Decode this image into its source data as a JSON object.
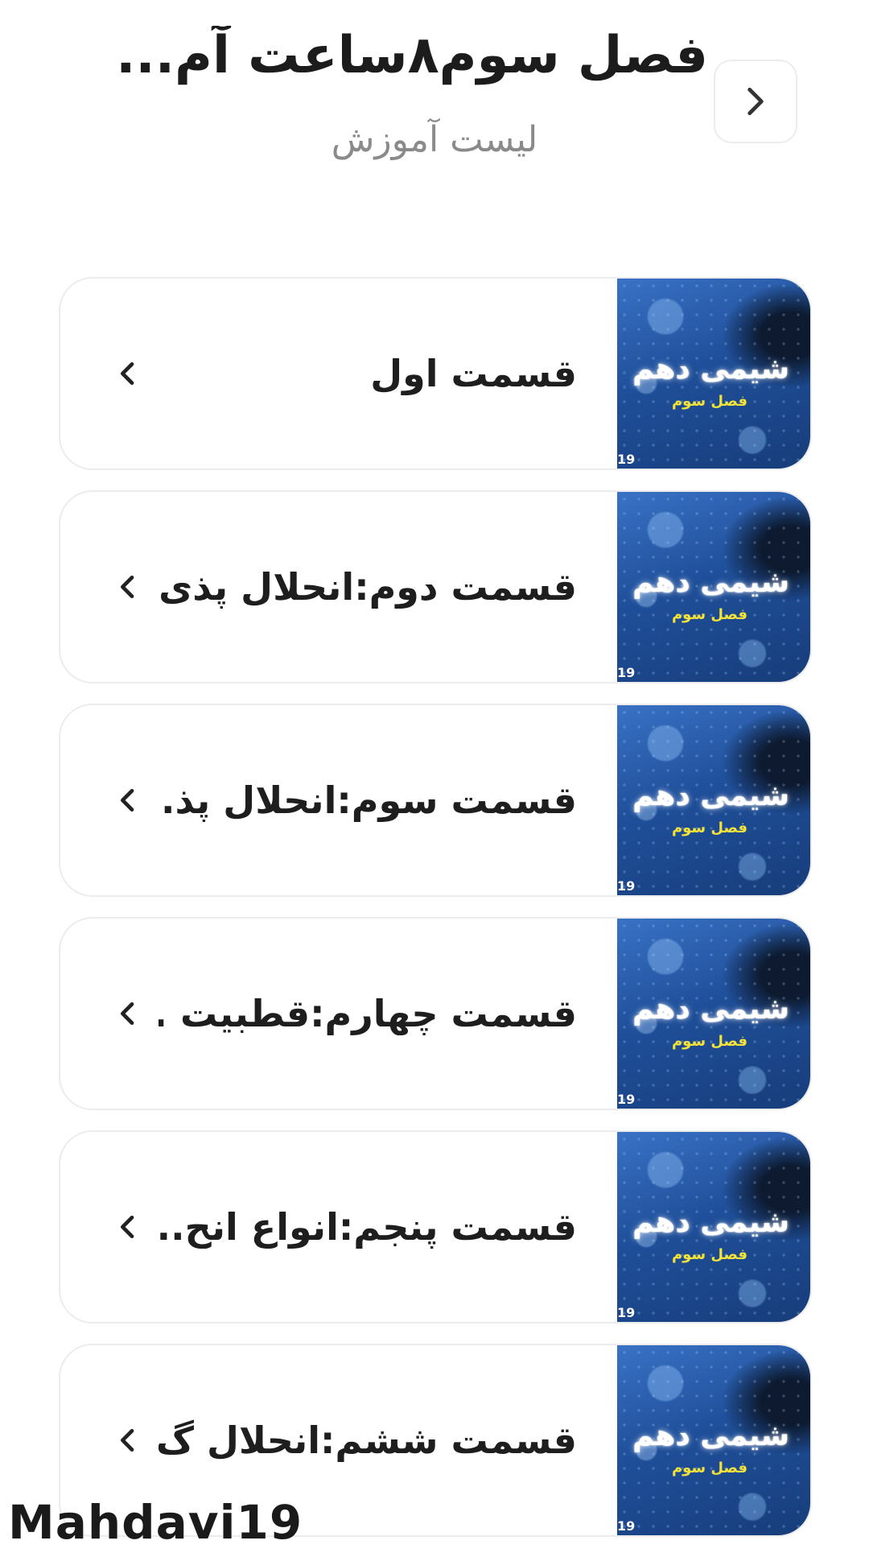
{
  "header": {
    "title": "فصل سوم۸ساعت آم...",
    "subtitle": "لیست آموزش",
    "back_icon": "chevron-right-icon"
  },
  "lessons": [
    {
      "title": "قسمت اول",
      "thumb_title": "شیمی دهم",
      "thumb_subtitle": "فصل سوم",
      "thumb_number": "19"
    },
    {
      "title": "قسمت دوم:انحلال پذی..",
      "thumb_title": "شیمی دهم",
      "thumb_subtitle": "فصل سوم",
      "thumb_number": "19"
    },
    {
      "title": "قسمت سوم:انحلال پذ...",
      "thumb_title": "شیمی دهم",
      "thumb_subtitle": "فصل سوم",
      "thumb_number": "19"
    },
    {
      "title": "قسمت چهارم:قطبیت ...",
      "thumb_title": "شیمی دهم",
      "thumb_subtitle": "فصل سوم",
      "thumb_number": "19"
    },
    {
      "title": "قسمت پنجم:انواع انح...",
      "thumb_title": "شیمی دهم",
      "thumb_subtitle": "فصل سوم",
      "thumb_number": "19"
    },
    {
      "title": "قسمت ششم:انحلال گ..",
      "thumb_title": "شیمی دهم",
      "thumb_subtitle": "فصل سوم",
      "thumb_number": "19"
    }
  ],
  "watermark": "Mahdavi19",
  "colors": {
    "background": "#ffffff",
    "card_border": "#ececec",
    "subtitle": "#8a8a8a",
    "thumb_blue": "#1f4f9a",
    "thumb_yellow": "#f2e23a"
  }
}
